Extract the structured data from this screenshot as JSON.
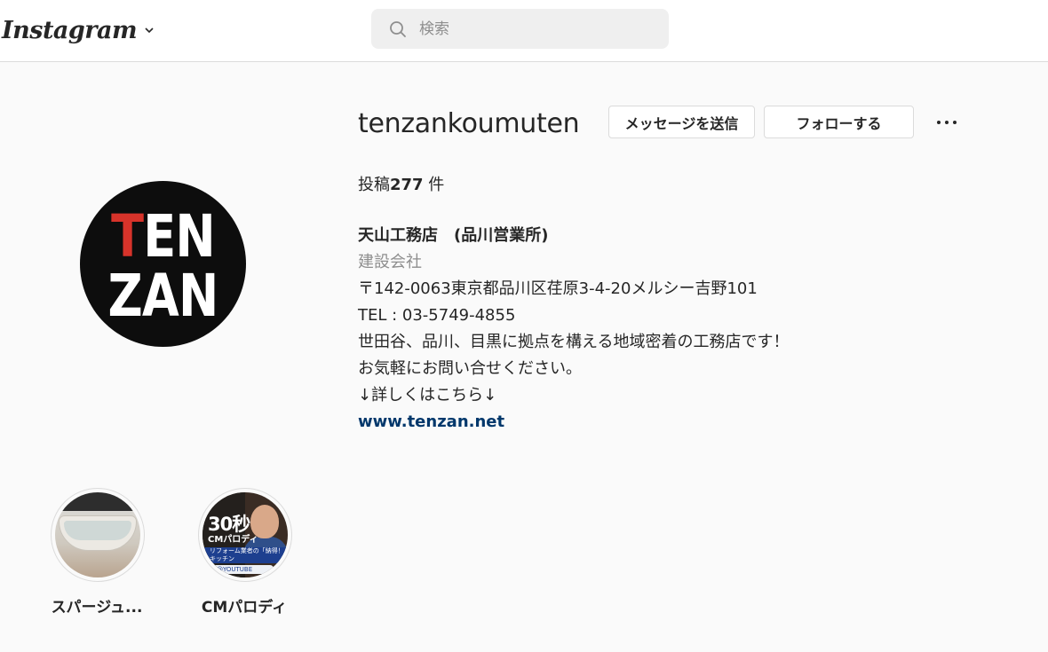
{
  "nav": {
    "brand": "Instagram",
    "search_placeholder": "検索"
  },
  "profile": {
    "username": "tenzankoumuten",
    "buttons": {
      "message": "メッセージを送信",
      "follow": "フォローする"
    },
    "posts_label": "投稿",
    "posts_count": "277",
    "posts_unit": " 件",
    "avatar": {
      "line1_first": "T",
      "line1_rest": "EN",
      "line2": "ZAN",
      "colors": {
        "background": "#0d0d0d",
        "red": "#d7332a",
        "white": "#ffffff"
      }
    },
    "bio": {
      "full_name": "天山工務店　(品川営業所)",
      "category": "建設会社",
      "lines": [
        "〒142-0063東京都品川区荏原3-4-20メルシー吉野101",
        "TEL : 03-5749-4855",
        "世田谷、品川、目黒に拠点を構える地域密着の工務店です！",
        "お気軽にお問い合せください。",
        "↓詳しくはこちら↓"
      ],
      "website": "www.tenzan.net"
    }
  },
  "highlights": [
    {
      "label": "スパージュ..."
    },
    {
      "label": "CMパロディ",
      "thumb_text": "30秒",
      "thumb_sub": "CMパロディ",
      "thumb_banner": "リフォーム業者の「納得！」キッチン",
      "thumb_badge": "@YOUTUBE"
    }
  ],
  "colors": {
    "link": "#00376b",
    "muted": "#8e8e8e",
    "border": "#dbdbdb",
    "background": "#fafafa"
  }
}
